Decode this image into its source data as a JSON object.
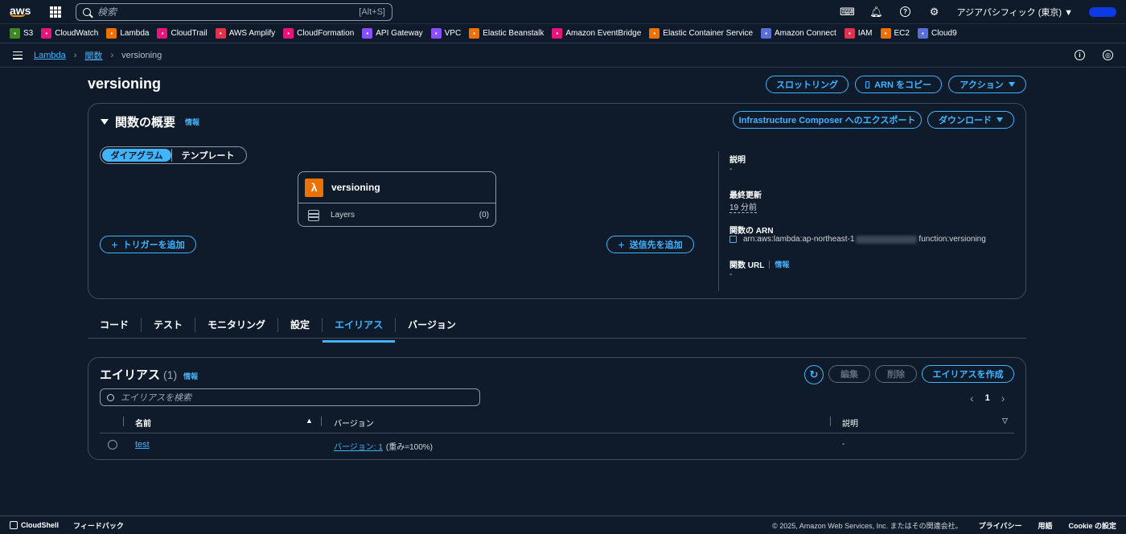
{
  "topnav": {
    "logo": "aws",
    "search_placeholder": "検索",
    "search_shortcut": "[Alt+S]",
    "region": "アジアパシフィック (東京) ▼"
  },
  "favorites": [
    {
      "label": "S3",
      "color": "#3f8624",
      "icon": "s3-icon"
    },
    {
      "label": "CloudWatch",
      "color": "#e7157b",
      "icon": "cloudwatch-icon"
    },
    {
      "label": "Lambda",
      "color": "#ed7100",
      "icon": "lambda-icon"
    },
    {
      "label": "CloudTrail",
      "color": "#e7157b",
      "icon": "cloudtrail-icon"
    },
    {
      "label": "AWS Amplify",
      "color": "#dd344c",
      "icon": "amplify-icon"
    },
    {
      "label": "CloudFormation",
      "color": "#e7157b",
      "icon": "cloudformation-icon"
    },
    {
      "label": "API Gateway",
      "color": "#8c4fff",
      "icon": "api-gateway-icon"
    },
    {
      "label": "VPC",
      "color": "#8c4fff",
      "icon": "vpc-icon"
    },
    {
      "label": "Elastic Beanstalk",
      "color": "#ed7100",
      "icon": "beanstalk-icon"
    },
    {
      "label": "Amazon EventBridge",
      "color": "#e7157b",
      "icon": "eventbridge-icon"
    },
    {
      "label": "Elastic Container Service",
      "color": "#ed7100",
      "icon": "ecs-icon"
    },
    {
      "label": "Amazon Connect",
      "color": "#5a6ed8",
      "icon": "connect-icon"
    },
    {
      "label": "IAM",
      "color": "#dd344c",
      "icon": "iam-icon"
    },
    {
      "label": "EC2",
      "color": "#ed7100",
      "icon": "ec2-icon"
    },
    {
      "label": "Cloud9",
      "color": "#5a6ed8",
      "icon": "cloud9-icon"
    }
  ],
  "breadcrumb": {
    "lambda": "Lambda",
    "functions": "関数",
    "current": "versioning"
  },
  "page": {
    "title": "versioning",
    "throttle": "スロットリング",
    "copy_arn": "ARN をコピー",
    "actions": "アクション"
  },
  "overview": {
    "heading": "関数の概要",
    "info": "情報",
    "export": "Infrastructure Composer へのエクスポート",
    "download": "ダウンロード",
    "seg_diagram": "ダイアグラム",
    "seg_template": "テンプレート",
    "function_name": "versioning",
    "layers_label": "Layers",
    "layers_count": "(0)",
    "add_trigger": "トリガーを追加",
    "add_destination": "送信先を追加",
    "desc_label": "説明",
    "desc_value": "-",
    "modified_label": "最終更新",
    "modified_value": "19 分前",
    "arn_label": "関数の ARN",
    "arn_prefix": "arn:aws:lambda:ap-northeast-1",
    "arn_suffix": "function:versioning",
    "url_label": "関数 URL",
    "url_info": "情報",
    "url_value": "-"
  },
  "tabs": [
    "コード",
    "テスト",
    "モニタリング",
    "設定",
    "エイリアス",
    "バージョン"
  ],
  "active_tab": "エイリアス",
  "aliases": {
    "heading": "エイリアス",
    "count": "(1)",
    "info": "情報",
    "edit": "編集",
    "delete": "削除",
    "create": "エイリアスを作成",
    "filter_placeholder": "エイリアスを検索",
    "page": "1",
    "columns": {
      "name": "名前",
      "version": "バージョン",
      "description": "説明"
    },
    "rows": [
      {
        "name": "test",
        "version_link": "バージョン: 1",
        "weight": "(重み=100%)",
        "description": "-"
      }
    ]
  },
  "footer": {
    "cloudshell": "CloudShell",
    "feedback": "フィードバック",
    "copyright": "© 2025, Amazon Web Services, Inc. またはその関連会社。",
    "privacy": "プライバシー",
    "terms": "用語",
    "cookie": "Cookie の設定"
  }
}
